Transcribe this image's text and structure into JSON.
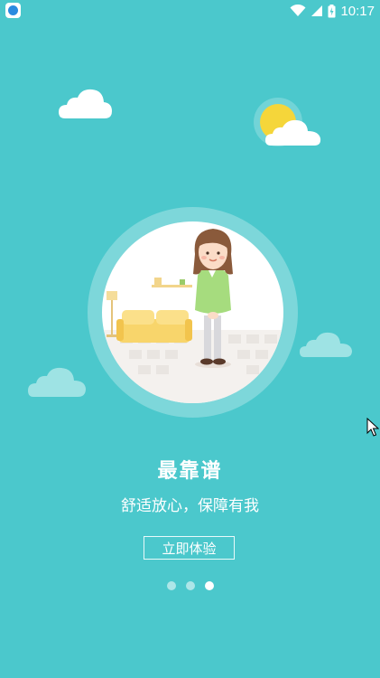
{
  "status_bar": {
    "time": "10:17",
    "icons": [
      "app-notification-icon",
      "wifi-icon",
      "signal-icon",
      "battery-charging-icon"
    ]
  },
  "slide": {
    "title": "最靠谱",
    "subtitle": "舒适放心，保障有我",
    "cta_label": "立即体验"
  },
  "pager": {
    "count": 3,
    "active_index": 2
  },
  "colors": {
    "background": "#4bc8cc",
    "cloud": "#ffffff",
    "cloud_faded": "#9ee3e4",
    "sun": "#f5d63a"
  }
}
